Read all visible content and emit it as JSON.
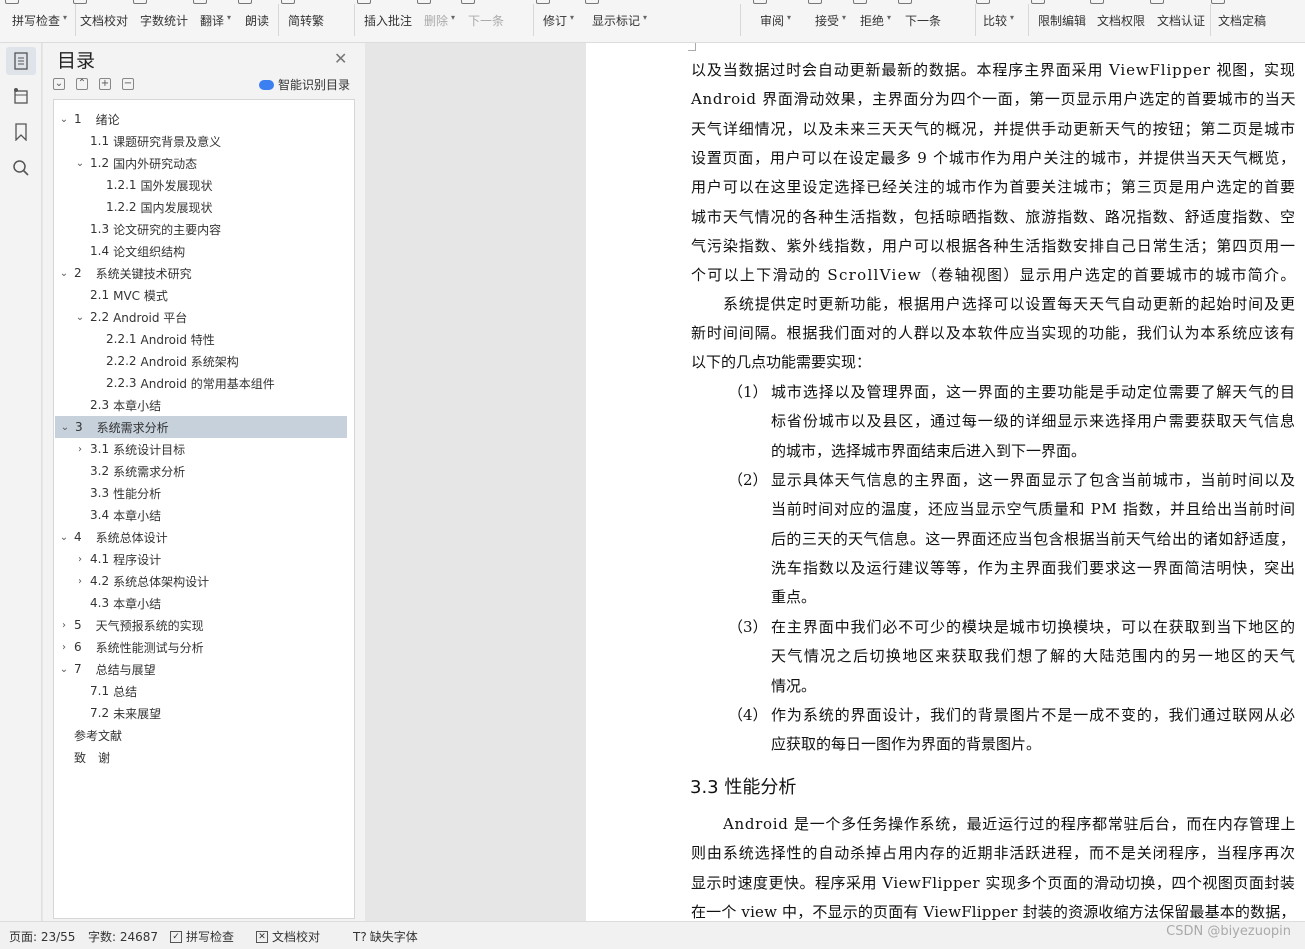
{
  "ribbon": {
    "items": [
      {
        "label": "拼写检查",
        "caret": true
      },
      {
        "label": "文档校对",
        "caret": false
      },
      {
        "label": "字数统计",
        "caret": false
      },
      {
        "label": "翻译",
        "caret": true
      },
      {
        "label": "朗读",
        "caret": false
      },
      {
        "label": "简转繁",
        "caret": false
      },
      {
        "label": "插入批注",
        "caret": false
      },
      {
        "label": "删除",
        "caret": true,
        "disabled": true
      },
      {
        "label": "下一条",
        "caret": false,
        "disabled": true
      },
      {
        "label": "修订",
        "caret": true
      },
      {
        "label": "显示标记",
        "caret": true
      },
      {
        "label": "审阅",
        "caret": true
      },
      {
        "label": "接受",
        "caret": true
      },
      {
        "label": "拒绝",
        "caret": true
      },
      {
        "label": "下一条",
        "caret": false
      },
      {
        "label": "比较",
        "caret": true
      },
      {
        "label": "限制编辑",
        "caret": false
      },
      {
        "label": "文档权限",
        "caret": false
      },
      {
        "label": "文档认证",
        "caret": false
      },
      {
        "label": "文档定稿",
        "caret": false
      }
    ]
  },
  "toc": {
    "title": "目录",
    "smart_label": "智能识别目录",
    "items": [
      {
        "num": "1",
        "text": "绪论",
        "level": 1,
        "toggle": "open"
      },
      {
        "num": "1.1",
        "text": "课题研究背景及意义",
        "level": 2,
        "toggle": ""
      },
      {
        "num": "1.2",
        "text": "国内外研究动态",
        "level": 2,
        "toggle": "open"
      },
      {
        "num": "1.2.1",
        "text": "国外发展现状",
        "level": 3,
        "toggle": ""
      },
      {
        "num": "1.2.2",
        "text": "国内发展现状",
        "level": 3,
        "toggle": ""
      },
      {
        "num": "1.3",
        "text": "论文研究的主要内容",
        "level": 2,
        "toggle": ""
      },
      {
        "num": "1.4",
        "text": "论文组织结构",
        "level": 2,
        "toggle": ""
      },
      {
        "num": "2",
        "text": "系统关键技术研究",
        "level": 1,
        "toggle": "open"
      },
      {
        "num": "2.1",
        "text": "MVC 模式",
        "level": 2,
        "toggle": ""
      },
      {
        "num": "2.2",
        "text": "Android 平台",
        "level": 2,
        "toggle": "open"
      },
      {
        "num": "2.2.1",
        "text": "Android 特性",
        "level": 3,
        "toggle": ""
      },
      {
        "num": "2.2.2",
        "text": "Android 系统架构",
        "level": 3,
        "toggle": ""
      },
      {
        "num": "2.2.3",
        "text": "Android 的常用基本组件",
        "level": 3,
        "toggle": ""
      },
      {
        "num": "2.3",
        "text": "本章小结",
        "level": 2,
        "toggle": ""
      },
      {
        "num": "3",
        "text": "系统需求分析",
        "level": 1,
        "toggle": "open",
        "selected": true
      },
      {
        "num": "3.1",
        "text": "系统设计目标",
        "level": 2,
        "toggle": "closed"
      },
      {
        "num": "3.2",
        "text": "系统需求分析",
        "level": 2,
        "toggle": ""
      },
      {
        "num": "3.3",
        "text": "性能分析",
        "level": 2,
        "toggle": ""
      },
      {
        "num": "3.4",
        "text": "本章小结",
        "level": 2,
        "toggle": ""
      },
      {
        "num": "4",
        "text": "系统总体设计",
        "level": 1,
        "toggle": "open"
      },
      {
        "num": "4.1",
        "text": "程序设计",
        "level": 2,
        "toggle": "closed"
      },
      {
        "num": "4.2",
        "text": "系统总体架构设计",
        "level": 2,
        "toggle": "closed"
      },
      {
        "num": "4.3",
        "text": "本章小结",
        "level": 2,
        "toggle": ""
      },
      {
        "num": "5",
        "text": "天气预报系统的实现",
        "level": 1,
        "toggle": "closed"
      },
      {
        "num": "6",
        "text": "系统性能测试与分析",
        "level": 1,
        "toggle": "closed"
      },
      {
        "num": "7",
        "text": "总结与展望",
        "level": 1,
        "toggle": "open"
      },
      {
        "num": "7.1",
        "text": "总结",
        "level": 2,
        "toggle": ""
      },
      {
        "num": "7.2",
        "text": "未来展望",
        "level": 2,
        "toggle": ""
      },
      {
        "num": "",
        "text": "参考文献",
        "level": 1,
        "toggle": ""
      },
      {
        "num": "",
        "text": "致　谢",
        "level": 1,
        "toggle": ""
      }
    ]
  },
  "document": {
    "lines": [
      "以及当数据过时会自动更新最新的数据。本程序主界面采用 ViewFlipper 视图，实现",
      "Android 界面滑动效果，主界面分为四个一面，第一页显示用户选定的首要城市的当天",
      "天气详细情况，以及未来三天天气的概况，并提供手动更新天气的按钮；第二页是城市",
      "设置页面，用户可以在设定最多 9 个城市作为用户关注的城市，并提供当天天气概览，",
      "用户可以在这里设定选择已经关注的城市作为首要关注城市；第三页是用户选定的首要",
      "城市天气情况的各种生活指数，包括晾晒指数、旅游指数、路况指数、舒适度指数、空",
      "气污染指数、紫外线指数，用户可以根据各种生活指数安排自己日常生活；第四页用一",
      "个可以上下滑动的 ScrollView（卷轴视图）显示用户选定的首要城市的城市简介。",
      "系统提供定时更新功能，根据用户选择可以设置每天天气自动更新的起始时间及更",
      "新时间间隔。根据我们面对的人群以及本软件应当实现的功能，我们认为本系统应该有",
      "以下的几点功能需要实现：",
      "（1）",
      "城市选择以及管理界面，这一界面的主要功能是手动定位需要了解天气的目",
      "标省份城市以及县区，通过每一级的详细显示来选择用户需要获取天气信息",
      "的城市，选择城市界面结束后进入到下一界面。",
      "（2）",
      "显示具体天气信息的主界面，这一界面显示了包含当前城市，当前时间以及",
      "当前时间对应的温度，还应当显示空气质量和 PM 指数，并且给出当前时间",
      "后的三天的天气信息。这一界面还应当包含根据当前天气给出的诸如舒适度，",
      "洗车指数以及运行建议等等，作为主界面我们要求这一界面简洁明快，突出",
      "重点。",
      "（3）",
      "在主界面中我们必不可少的模块是城市切换模块，可以在获取到当下地区的",
      "天气情况之后切换地区来获取我们想了解的大陆范围内的另一地区的天气",
      "情况。",
      "（4）",
      "作为系统的界面设计，我们的背景图片不是一成不变的，我们通过联网从必",
      "应获取的每日一图作为界面的背景图片。",
      "Android 是一个多任务操作系统，最近运行过的程序都常驻后台，而在内存管理上",
      "则由系统选择性的自动杀掉占用内存的近期非活跃进程，而不是关闭程序，当程序再次",
      "显示时速度更快。程序采用 ViewFlipper 实现多个页面的滑动切换，四个视图页面封装",
      "在一个 view 中，不显示的页面有 ViewFlipper 封装的资源收缩方法保留最基本的数据，"
    ],
    "heading": "3.3 性能分析"
  },
  "status": {
    "page": "页面: 23/55",
    "words": "字数: 24687",
    "spell": "拼写检查",
    "proof": "文档校对",
    "font": "缺失字体"
  },
  "watermark": "CSDN @biyezuopin"
}
